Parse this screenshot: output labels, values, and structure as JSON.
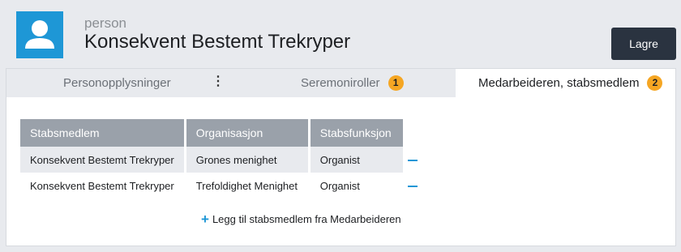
{
  "header": {
    "subtitle": "person",
    "title": "Konsekvent Bestemt Trekryper",
    "save_label": "Lagre"
  },
  "colors": {
    "accent": "#1e97d6",
    "badge": "#f5a623",
    "button": "#2a3340",
    "table_header": "#9aa1aa"
  },
  "tabs": [
    {
      "label": "Personopplysninger"
    },
    {
      "label": "Seremoniroller",
      "badge": "1"
    },
    {
      "label": "Medarbeideren, stabsmedlem",
      "badge": "2",
      "active": true
    }
  ],
  "table": {
    "headers": [
      "Stabsmedlem",
      "Organisasjon",
      "Stabsfunksjon"
    ],
    "rows": [
      {
        "name": "Konsekvent Bestemt Trekryper",
        "org": "Grones menighet",
        "func": "Organist"
      },
      {
        "name": "Konsekvent Bestemt Trekryper",
        "org": "Trefoldighet Menighet",
        "func": "Organist"
      }
    ]
  },
  "add_link_label": "Legg til stabsmedlem fra Medarbeideren"
}
